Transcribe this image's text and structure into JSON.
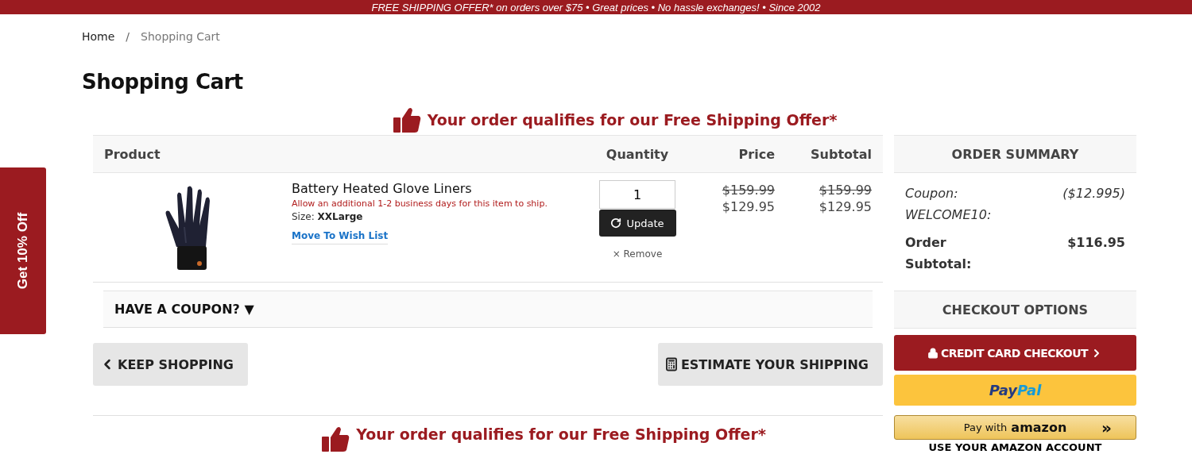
{
  "promo_banner": "FREE SHIPPING OFFER* on orders over $75 • Great prices • No hassle exchanges! • Since 2002",
  "breadcrumb": [
    {
      "label": "Home",
      "current": false
    },
    {
      "label": "Shopping Cart",
      "current": true
    }
  ],
  "breadcrumb_separator": "/",
  "title": "Shopping Cart",
  "side_tab": "Get 10% Off",
  "shipping_notice": "Your order qualifies for our Free Shipping Offer*",
  "table": {
    "columns": [
      "Product",
      "Quantity",
      "Price",
      "Subtotal"
    ],
    "rows": [
      {
        "name": "Battery Heated Glove Liners",
        "note": "Allow an additional 1-2 business days for this item to ship.",
        "size_label": "Size:",
        "size": "XXLarge",
        "wish_link": "Move To Wish List",
        "quantity": "1",
        "update": "Update",
        "remove": "× Remove",
        "price_old": "$159.99",
        "price": "$129.95",
        "subtotal_old": "$159.99",
        "subtotal": "$129.95"
      }
    ]
  },
  "coupon_toggle": {
    "label": "HAVE A COUPON?",
    "arrow": "▼",
    "expanded": false
  },
  "keep_shopping": "KEEP SHOPPING",
  "estimate_shipping": "ESTIMATE YOUR SHIPPING",
  "order_summary": {
    "title": "ORDER SUMMARY",
    "lines": [
      {
        "kind": "discount",
        "label": "Coupon: WELCOME10:",
        "value": "($12.995)"
      },
      {
        "kind": "total",
        "label": "Order Subtotal:",
        "value": "$116.95"
      }
    ]
  },
  "checkout_options": {
    "title": "CHECKOUT OPTIONS",
    "credit_card": "CREDIT CARD CHECKOUT",
    "paypal": [
      "Pay",
      "Pal"
    ],
    "amazon": {
      "prefix": "Pay with",
      "brand": "amazon",
      "arrows": "»"
    },
    "amazon_note": "USE YOUR AMAZON ACCOUNT"
  },
  "shipping_notice_bottom": "Your order qualifies for our Free Shipping Offer*"
}
